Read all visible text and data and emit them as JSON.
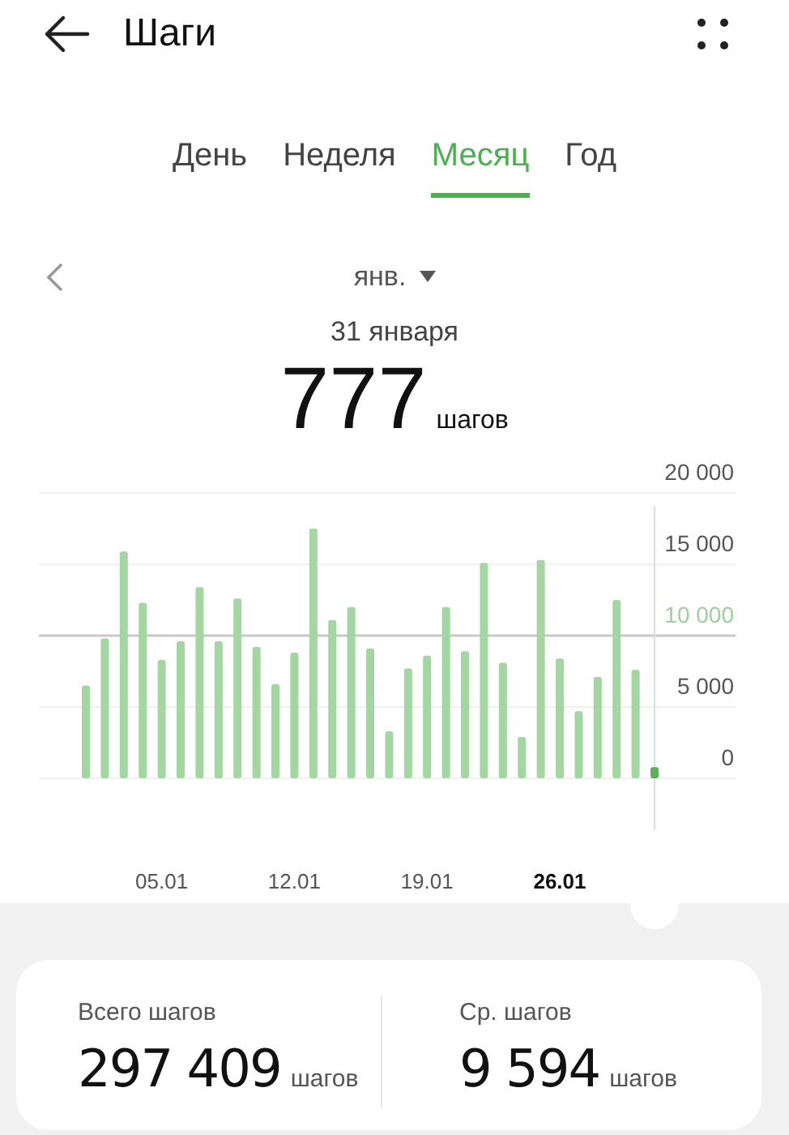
{
  "header": {
    "title": "Шаги"
  },
  "tabs": [
    {
      "label": "День",
      "selected": false
    },
    {
      "label": "Неделя",
      "selected": false
    },
    {
      "label": "Месяц",
      "selected": true
    },
    {
      "label": "Год",
      "selected": false
    }
  ],
  "period": {
    "label": "янв.",
    "date": "31 января",
    "value": "777",
    "unit": "шагов"
  },
  "chart_data": {
    "type": "bar",
    "categories": [
      null,
      null,
      null,
      null,
      "05.01",
      null,
      null,
      null,
      null,
      null,
      null,
      "12.01",
      null,
      null,
      null,
      null,
      null,
      null,
      "19.01",
      null,
      null,
      null,
      null,
      null,
      null,
      "26.01",
      null,
      null,
      null,
      null,
      null
    ],
    "series": [
      {
        "color": "#a3d6a0",
        "values": [
          6500,
          9800,
          15900,
          12300,
          8300,
          9600,
          13400,
          9600,
          12600,
          9200,
          6600,
          8800,
          17500,
          11100,
          12000,
          9100,
          3300,
          7700,
          8600,
          12000,
          8900,
          15100,
          8100,
          2900,
          15300,
          8400,
          4700,
          7100,
          12500,
          7600,
          null
        ]
      },
      {
        "color": "#5fb05a",
        "values": [
          null,
          null,
          null,
          null,
          null,
          null,
          null,
          null,
          null,
          null,
          null,
          null,
          null,
          null,
          null,
          null,
          null,
          null,
          null,
          null,
          null,
          null,
          null,
          null,
          null,
          null,
          null,
          null,
          null,
          null,
          777
        ]
      }
    ],
    "ylim": [
      0,
      20000
    ],
    "yticks": [
      {
        "value": 0,
        "label": "0"
      },
      {
        "value": 5000,
        "label": "5 000"
      },
      {
        "value": 10000,
        "label": "10 000"
      },
      {
        "value": 15000,
        "label": "15 000"
      },
      {
        "value": 20000,
        "label": "20 000"
      }
    ],
    "ref_lines": [
      {
        "axis": "y",
        "value": 10000
      }
    ]
  },
  "summary": [
    {
      "label": "Всего шагов",
      "value": "297 409",
      "unit": "шагов"
    },
    {
      "label": "Ср. шагов",
      "value": "9 594",
      "unit": "шагов"
    }
  ]
}
